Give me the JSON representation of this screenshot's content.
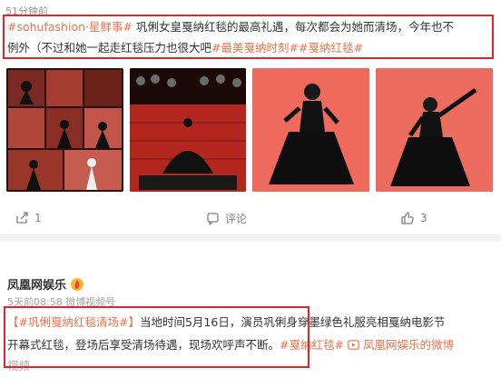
{
  "post1": {
    "time": "51分钟前",
    "tag_sohu": "#sohufashion·星鲜事#",
    "text_a": "巩俐女皇戛纳红毯的最高礼遇，每次都会为她而清场，今年也不",
    "text_b": "例外（不过和她一起走红毯压力也很大吧",
    "tag_moments": "#最美戛纳时刻#",
    "tag_redcarpet": "#戛纳红毯#",
    "actions": {
      "repost_count": "1",
      "comment_label": "评论",
      "like_count": "3"
    }
  },
  "post2": {
    "author": "凤凰网娱乐",
    "meta": "5天前08:58 微博视频号",
    "bracket_open": "【",
    "topic": "#巩俐戛纳红毯清场#",
    "bracket_close": "】",
    "text_a": "当地时间5月16日，演员巩俐身穿墨绿色礼服亮相戛纳电影节",
    "text_b": "开幕式红毯，登场后享受清场待遇，现场欢呼声不断。",
    "tag_redcarpet": "#戛纳红毯#",
    "video_link": "凤凰网娱乐的微博",
    "partial_line": "视频"
  },
  "colors": {
    "accent": "#eb7350",
    "highlight_box": "#e8222a",
    "muted": "#808080"
  },
  "icons": {
    "repost": "repost-icon",
    "comment": "comment-icon",
    "like": "thumbs-up-icon",
    "badge": "fire-badge-icon",
    "video": "video-icon"
  }
}
